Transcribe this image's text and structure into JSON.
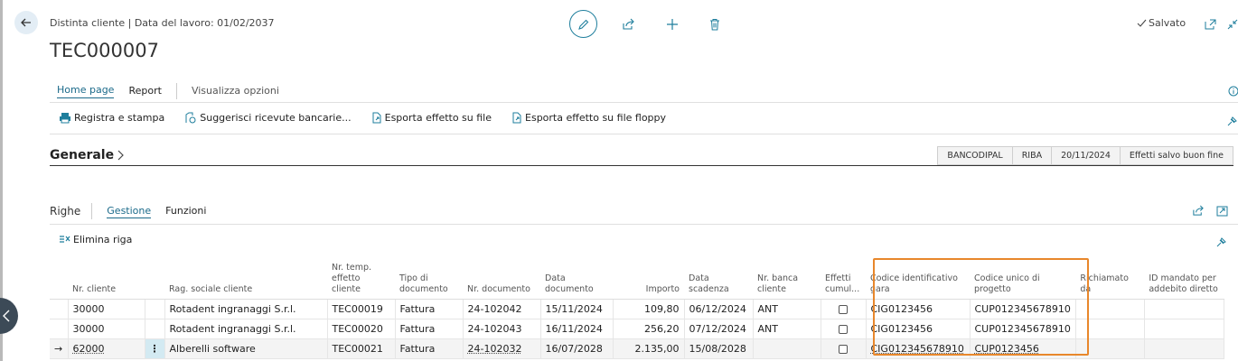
{
  "header": {
    "breadcrumb": "Distinta cliente | Data del lavoro: 01/02/2037",
    "title": "TEC000007",
    "saved_label": "Salvato"
  },
  "nav": {
    "tabs": [
      "Home page",
      "Report"
    ],
    "view_options": "Visualizza opzioni"
  },
  "actions": {
    "register_print": "Registra e stampa",
    "suggest_receipts": "Suggerisci ricevute bancarie...",
    "export_file": "Esporta effetto su file",
    "export_floppy": "Esporta effetto su file floppy"
  },
  "general": {
    "title": "Generale",
    "badges": [
      "BANCODIPAL",
      "RIBA",
      "20/11/2024",
      "Effetti salvo buon fine"
    ]
  },
  "lines": {
    "title": "Righe",
    "tabs": [
      "Gestione",
      "Funzioni"
    ],
    "delete_row": "Elimina riga",
    "columns": {
      "customer_no": "Nr. cliente",
      "customer_name": "Rag. sociale cliente",
      "temp_no": "Nr. temp. effetto cliente",
      "doc_type": "Tipo di documento",
      "doc_no": "Nr. documento",
      "doc_date": "Data documento",
      "amount": "Importo",
      "due_date": "Data scadenza",
      "bank_no": "Nr. banca cliente",
      "cumulative": "Effetti cumul...",
      "cig": "Codice identificativo gara",
      "cup": "Codice unico di progetto",
      "recalled": "Richiamato da",
      "mandate_id": "ID mandato per addebito diretto"
    },
    "rows": [
      {
        "customer_no": "30000",
        "customer_name": "Rotadent ingranaggi S.r.l.",
        "temp_no": "TEC00019",
        "doc_type": "Fattura",
        "doc_no": "24-102042",
        "doc_date": "15/11/2024",
        "amount": "109,80",
        "due_date": "06/12/2024",
        "bank_no": "ANT",
        "cumulative": false,
        "cig": "CIG0123456",
        "cup": "CUP012345678910",
        "recalled": "",
        "mandate_id": ""
      },
      {
        "customer_no": "30000",
        "customer_name": "Rotadent ingranaggi S.r.l.",
        "temp_no": "TEC00020",
        "doc_type": "Fattura",
        "doc_no": "24-102043",
        "doc_date": "16/11/2024",
        "amount": "256,20",
        "due_date": "07/12/2024",
        "bank_no": "ANT",
        "cumulative": false,
        "cig": "CIG0123456",
        "cup": "CUP012345678910",
        "recalled": "",
        "mandate_id": ""
      },
      {
        "customer_no": "62000",
        "customer_name": "Alberelli software",
        "temp_no": "TEC00021",
        "doc_type": "Fattura",
        "doc_no": "24-102032",
        "doc_date": "16/07/2028",
        "amount": "2.135,00",
        "due_date": "15/08/2028",
        "bank_no": "",
        "cumulative": false,
        "cig": "CIG012345678910",
        "cup": "CUP0123456",
        "recalled": "",
        "mandate_id": ""
      }
    ],
    "row_arrow": "→",
    "row_menu": "⋮"
  },
  "colors": {
    "accent": "#1b6a8a",
    "highlight_border": "#e8872b"
  }
}
